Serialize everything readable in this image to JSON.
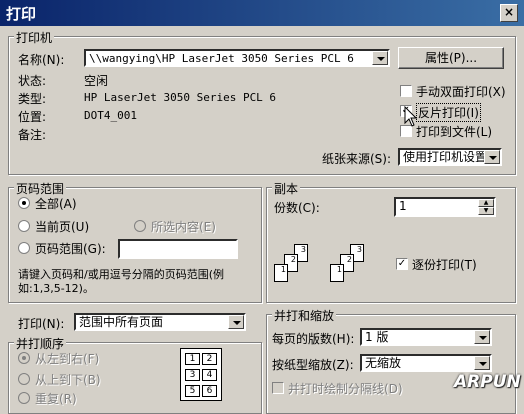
{
  "window": {
    "title": "打印",
    "close": "×"
  },
  "printer": {
    "legend": "打印机",
    "name_label": "名称(N):",
    "name_value": "\\\\wangying\\HP LaserJet 3050 Series PCL 6",
    "props_button": "属性(P)...",
    "status_label": "状态:",
    "status_value": "空闲",
    "type_label": "类型:",
    "type_value": "HP LaserJet 3050 Series PCL 6",
    "location_label": "位置:",
    "location_value": "DOT4_001",
    "comment_label": "备注:",
    "duplex_label": "手动双面打印(X)",
    "reverse_label": "反片打印(I)",
    "tofile_label": "打印到文件(L)",
    "source_label": "纸张来源(S):",
    "source_value": "使用打印机设置"
  },
  "page_range": {
    "legend": "页码范围",
    "all": "全部(A)",
    "current": "当前页(U)",
    "selection": "所选内容(E)",
    "pages": "页码范围(G):",
    "pages_value": "",
    "hint": "请键入页码和/或用逗号分隔的页码范围(例如:1,3,5-12)。"
  },
  "copies": {
    "legend": "副本",
    "count_label": "份数(C):",
    "count_value": "1",
    "collate_label": "逐份打印(T)"
  },
  "print_what": {
    "label": "打印(N):",
    "value": "范围中所有页面"
  },
  "order": {
    "legend": "并打顺序",
    "ltr": "从左到右(F)",
    "ttb": "从上到下(B)",
    "repeat": "重复(R)"
  },
  "zoom": {
    "legend": "并打和缩放",
    "per_sheet_label": "每页的版数(H):",
    "per_sheet_value": "1 版",
    "scale_label": "按纸型缩放(Z):",
    "scale_value": "无缩放",
    "border_label": "并打时绘制分隔线(D)"
  },
  "watermark": "ARPUN"
}
